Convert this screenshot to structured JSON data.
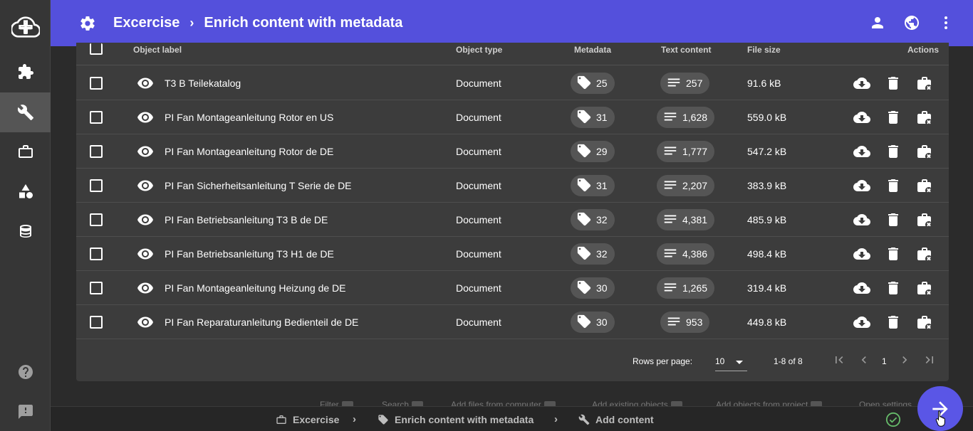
{
  "appbar": {
    "crumb1": "Excercise",
    "crumb2": "Enrich content with metadata",
    "separator": "›"
  },
  "sidebar": {
    "items": [
      "cloud-upload-icon",
      "puzzle-icon",
      "wrench-icon",
      "briefcase-icon",
      "shapes-icon",
      "database-icon",
      "help-icon",
      "feedback-icon"
    ],
    "active": "wrench-icon"
  },
  "table": {
    "headers": {
      "label": "Object label",
      "type": "Object type",
      "metadata": "Metadata",
      "text": "Text content",
      "size": "File size",
      "actions": "Actions"
    },
    "rows": [
      {
        "label": "T3 B Teilekatalog",
        "type": "Document",
        "metadata": "25",
        "text": "257",
        "size": "91.6 kB"
      },
      {
        "label": "PI Fan Montageanleitung Rotor en US",
        "type": "Document",
        "metadata": "31",
        "text": "1,628",
        "size": "559.0 kB"
      },
      {
        "label": "PI Fan Montageanleitung Rotor de DE",
        "type": "Document",
        "metadata": "29",
        "text": "1,777",
        "size": "547.2 kB"
      },
      {
        "label": "PI Fan Sicherheitsanleitung T Serie de DE",
        "type": "Document",
        "metadata": "31",
        "text": "2,207",
        "size": "383.9 kB"
      },
      {
        "label": "PI Fan Betriebsanleitung T3 B de DE",
        "type": "Document",
        "metadata": "32",
        "text": "4,381",
        "size": "485.9 kB"
      },
      {
        "label": "PI Fan Betriebsanleitung T3 H1 de DE",
        "type": "Document",
        "metadata": "32",
        "text": "4,386",
        "size": "498.4 kB"
      },
      {
        "label": "PI Fan Montageanleitung Heizung de DE",
        "type": "Document",
        "metadata": "30",
        "text": "1,265",
        "size": "319.4 kB"
      },
      {
        "label": "PI Fan Reparaturanleitung Bedienteil de DE",
        "type": "Document",
        "metadata": "30",
        "text": "953",
        "size": "449.8 kB"
      }
    ]
  },
  "pagination": {
    "rows_per_page_label": "Rows per page:",
    "rows_per_page": "10",
    "range": "1-8 of 8",
    "page": "1"
  },
  "hints": {
    "filter": "Filter",
    "search": "Search",
    "add_files": "Add files from computer",
    "add_existing": "Add existing objects",
    "add_project": "Add objects from project",
    "open_settings": "Open settings"
  },
  "stepbar": {
    "step1": "Excercise",
    "step2": "Enrich content with metadata",
    "step3": "Add content",
    "separator": "›"
  },
  "colors": {
    "appbar": "#5450dc",
    "fab": "#5a56e6",
    "check": "#66bb6a"
  }
}
